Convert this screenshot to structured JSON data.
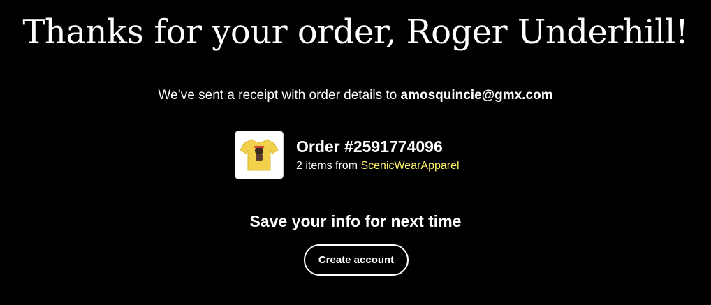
{
  "header": {
    "title": "Thanks for your order, Roger Underhill!"
  },
  "receipt": {
    "text": "We’ve sent a receipt with order details to ",
    "email": "amosquincie@gmx.com"
  },
  "order": {
    "thumbnail_icon": "yellow-tshirt-product-image",
    "number": "Order #2591774096",
    "items_text": "2 items from ",
    "shop_link": "ScenicWearApparel",
    "link_color": "#fff36b"
  },
  "save_info": {
    "title": "Save your info for next time",
    "button_label": "Create account"
  }
}
